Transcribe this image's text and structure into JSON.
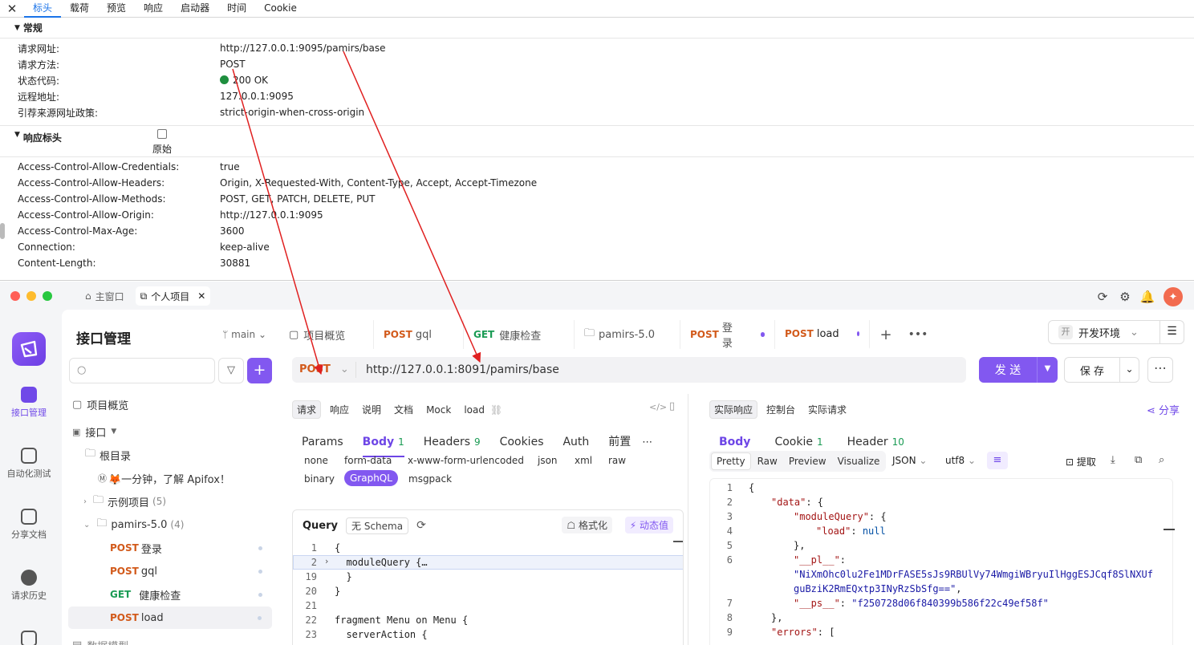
{
  "devtools": {
    "tabs": [
      "标头",
      "载荷",
      "预览",
      "响应",
      "启动器",
      "时间",
      "Cookie"
    ],
    "general": {
      "title": "常规",
      "rows": [
        {
          "k": "请求网址:",
          "v": "http://127.0.0.1:9095/pamirs/base"
        },
        {
          "k": "请求方法:",
          "v": "POST"
        },
        {
          "k": "状态代码:",
          "v": "200 OK"
        },
        {
          "k": "远程地址:",
          "v": "127.0.0.1:9095"
        },
        {
          "k": "引荐来源网址政策:",
          "v": "strict-origin-when-cross-origin"
        }
      ]
    },
    "response_headers": {
      "title": "响应标头",
      "raw_label": "原始",
      "rows": [
        {
          "k": "Access-Control-Allow-Credentials:",
          "v": "true"
        },
        {
          "k": "Access-Control-Allow-Headers:",
          "v": "Origin, X-Requested-With, Content-Type, Accept, Accept-Timezone"
        },
        {
          "k": "Access-Control-Allow-Methods:",
          "v": "POST, GET, PATCH, DELETE, PUT"
        },
        {
          "k": "Access-Control-Allow-Origin:",
          "v": "http://127.0.0.1:9095"
        },
        {
          "k": "Access-Control-Max-Age:",
          "v": "3600"
        },
        {
          "k": "Connection:",
          "v": "keep-alive"
        },
        {
          "k": "Content-Length:",
          "v": "30881"
        }
      ]
    }
  },
  "window": {
    "tabs": [
      {
        "label": "主窗口",
        "icon": "home-icon"
      },
      {
        "label": "个人项目",
        "icon": "external-icon"
      }
    ]
  },
  "rail": [
    {
      "label": "接口管理",
      "icon": "api-icon"
    },
    {
      "label": "自动化测试",
      "icon": "automation-icon"
    },
    {
      "label": "分享文档",
      "icon": "share-doc-icon"
    },
    {
      "label": "请求历史",
      "icon": "history-icon"
    }
  ],
  "sidebar": {
    "title": "接口管理",
    "branch": "main",
    "overview": "项目概览",
    "api_root": "接口",
    "root_dir": "根目录",
    "doc_item": "🦊一分钟，了解 Apifox！",
    "example_folder": "示例项目",
    "example_count": "(5)",
    "pamirs_folder": "pamirs-5.0",
    "pamirs_count": "(4)",
    "endpoints": [
      {
        "method": "POST",
        "name": "登录"
      },
      {
        "method": "POST",
        "name": "gql"
      },
      {
        "method": "GET",
        "name": "健康检查"
      },
      {
        "method": "POST",
        "name": "load"
      }
    ],
    "next_section": "数据模型"
  },
  "main": {
    "tabs": [
      {
        "method": "",
        "label": "项目概览"
      },
      {
        "method": "POST",
        "label": "gql"
      },
      {
        "method": "GET",
        "label": "健康检查"
      },
      {
        "method": "",
        "label": "pamirs-5.0"
      },
      {
        "method": "POST",
        "label": "登录"
      },
      {
        "method": "POST",
        "label": "load"
      }
    ],
    "env": "开发环境",
    "env_badge": "开",
    "method": "POST",
    "url": "http://127.0.0.1:8091/pamirs/base",
    "send": "发 送",
    "save": "保 存"
  },
  "request": {
    "top_chips": [
      "请求",
      "响应",
      "说明",
      "文档",
      "Mock",
      "load"
    ],
    "tabs": [
      {
        "label": "Params",
        "count": ""
      },
      {
        "label": "Body",
        "count": "1"
      },
      {
        "label": "Headers",
        "count": "9"
      },
      {
        "label": "Cookies",
        "count": ""
      },
      {
        "label": "Auth",
        "count": ""
      },
      {
        "label": "前置",
        "count": ""
      }
    ],
    "body_types": [
      "none",
      "form-data",
      "x-www-form-urlencoded",
      "json",
      "xml",
      "raw",
      "binary",
      "GraphQL",
      "msgpack"
    ],
    "query_title": "Query",
    "schema": "无 Schema",
    "format": "格式化",
    "dynamic": "动态值",
    "code": [
      {
        "ln": "1",
        "tx": "{"
      },
      {
        "ln": "2",
        "tx": "  moduleQuery {…"
      },
      {
        "ln": "19",
        "tx": "  }"
      },
      {
        "ln": "20",
        "tx": "}"
      },
      {
        "ln": "21",
        "tx": ""
      },
      {
        "ln": "22",
        "tx": "fragment Menu on Menu {"
      },
      {
        "ln": "23",
        "tx": "  serverAction {"
      }
    ]
  },
  "response": {
    "top_chips": [
      "实际响应",
      "控制台",
      "实际请求"
    ],
    "share": "分享",
    "tabs": [
      {
        "label": "Body",
        "count": ""
      },
      {
        "label": "Cookie",
        "count": "1"
      },
      {
        "label": "Header",
        "count": "10"
      }
    ],
    "view_modes": [
      "Pretty",
      "Raw",
      "Preview",
      "Visualize"
    ],
    "format": "JSON",
    "encoding": "utf8",
    "extract": "提取",
    "json_lines": [
      {
        "ln": "1",
        "parts": [
          [
            "p",
            "{"
          ]
        ],
        "indent": 0
      },
      {
        "ln": "2",
        "parts": [
          [
            "k",
            "\"data\""
          ],
          [
            "p",
            ": {"
          ]
        ],
        "indent": 1
      },
      {
        "ln": "3",
        "parts": [
          [
            "k",
            "\"moduleQuery\""
          ],
          [
            "p",
            ": {"
          ]
        ],
        "indent": 2
      },
      {
        "ln": "4",
        "parts": [
          [
            "k",
            "\"load\""
          ],
          [
            "p",
            ": "
          ],
          [
            "n",
            "null"
          ]
        ],
        "indent": 3
      },
      {
        "ln": "5",
        "parts": [
          [
            "p",
            "},"
          ]
        ],
        "indent": 2
      },
      {
        "ln": "6",
        "parts": [
          [
            "k",
            "\"__pl__\""
          ],
          [
            "p",
            ":"
          ]
        ],
        "indent": 2
      },
      {
        "ln": "",
        "parts": [
          [
            "s",
            "\"NiXmOhc0lu2Fe1MDrFASE5sJs9RBUlVy74WmgiWBryuIlHggESJCqf8SlNXUf"
          ]
        ],
        "indent": 2
      },
      {
        "ln": "",
        "parts": [
          [
            "s",
            "guBziK2RmEQxtp3INyRzSbSfg==\""
          ],
          [
            "p",
            ","
          ]
        ],
        "indent": 2
      },
      {
        "ln": "7",
        "parts": [
          [
            "k",
            "\"__ps__\""
          ],
          [
            "p",
            ": "
          ],
          [
            "s",
            "\"f250728d06f840399b586f22c49ef58f\""
          ]
        ],
        "indent": 2
      },
      {
        "ln": "8",
        "parts": [
          [
            "p",
            "},"
          ]
        ],
        "indent": 1
      },
      {
        "ln": "9",
        "parts": [
          [
            "k",
            "\"errors\""
          ],
          [
            "p",
            ": ["
          ]
        ],
        "indent": 1
      }
    ]
  },
  "colors": {
    "accent": "#8258f0",
    "post": "#d25a1b",
    "get": "#1a9b54",
    "arrow": "#e02020",
    "devtools_active": "#1a73e8"
  }
}
